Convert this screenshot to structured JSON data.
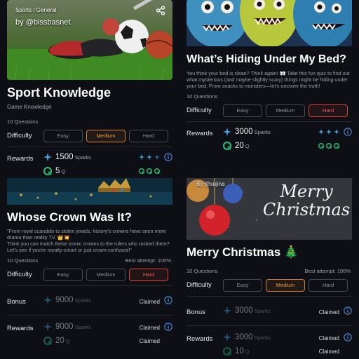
{
  "cards": [
    {
      "category": "Sports / General",
      "author": "by @bissbasnet",
      "title": "Sport Knowledge",
      "subtitle": "Game Knowledge",
      "questions": "10 Questions",
      "difficulty_label": "Difficulty",
      "difficulty_options": [
        "Easy",
        "Medium",
        "Hard"
      ],
      "difficulty_selected": "Medium",
      "rewards_label": "Rewards",
      "sparks_value": "1500",
      "sparks_unit": "Sparks",
      "q_value": "5",
      "q_unit": "Q"
    },
    {
      "title": "What’s Hiding Under My Bed?",
      "description": "You think your bed is clean? Think again! 👀 Take this fun quiz to find out what mysterious (and maybe slightly scary) things might be hiding under your bed. From snacks to monsters—let’s uncover the truth!",
      "questions": "10 Questions",
      "difficulty_label": "Difficulty",
      "difficulty_options": [
        "Easy",
        "Medium",
        "Hard"
      ],
      "difficulty_selected": "Hard",
      "rewards_label": "Rewards",
      "sparks_value": "3000",
      "sparks_unit": "Sparks",
      "q_value": "20",
      "q_unit": "Q"
    },
    {
      "title": "Whose Crown Was It?",
      "description": "\"From royal scandals to stolen jewels, history's crowns have seen more drama than reality TV. 👑💥\nThink you can match these iconic crowns to the rulers who rocked them?\nLet's see if you're royalty-smart or just crown-confused!\"",
      "questions": "10 Questions",
      "best_attempt": "Best attempt: 100%",
      "difficulty_label": "Difficulty",
      "difficulty_options": [
        "Easy",
        "Medium",
        "Hard"
      ],
      "difficulty_selected": "Hard",
      "bonus_label": "Bonus",
      "bonus_value": "9000",
      "bonus_unit": "Sparks",
      "bonus_status": "Claimed",
      "rewards_label": "Rewards",
      "sparks_value": "9000",
      "sparks_unit": "Sparks",
      "sparks_status": "Claimed",
      "q_value": "20",
      "q_unit": "Q",
      "q_status": "Claimed"
    },
    {
      "author": "By @sujina",
      "banner_script": "Merry Christmas",
      "title": "Merry Christmas 🎄",
      "questions": "10 Questions",
      "best_attempt": "Best attempt: 100%",
      "difficulty_label": "Difficulty",
      "difficulty_options": [
        "Easy",
        "Medium",
        "Hard"
      ],
      "difficulty_selected": "Medium",
      "bonus_label": "Bonus",
      "bonus_value": "3000",
      "bonus_unit": "Sparks",
      "bonus_status": "Claimed",
      "rewards_label": "Rewards",
      "sparks_value": "3000",
      "sparks_unit": "Sparks",
      "sparks_status": "Claimed",
      "q_value": "10",
      "q_unit": "Q",
      "q_status": "Claimed"
    }
  ],
  "icons": {
    "spark": "spark-icon",
    "q": "q-coin-icon",
    "info": "info-icon",
    "share": "share-icon"
  },
  "colors": {
    "accent_medium": "#d9812e",
    "accent_hard": "#d9453a",
    "spark_blue": "#3fa7e8",
    "q_green": "#2bb673"
  }
}
